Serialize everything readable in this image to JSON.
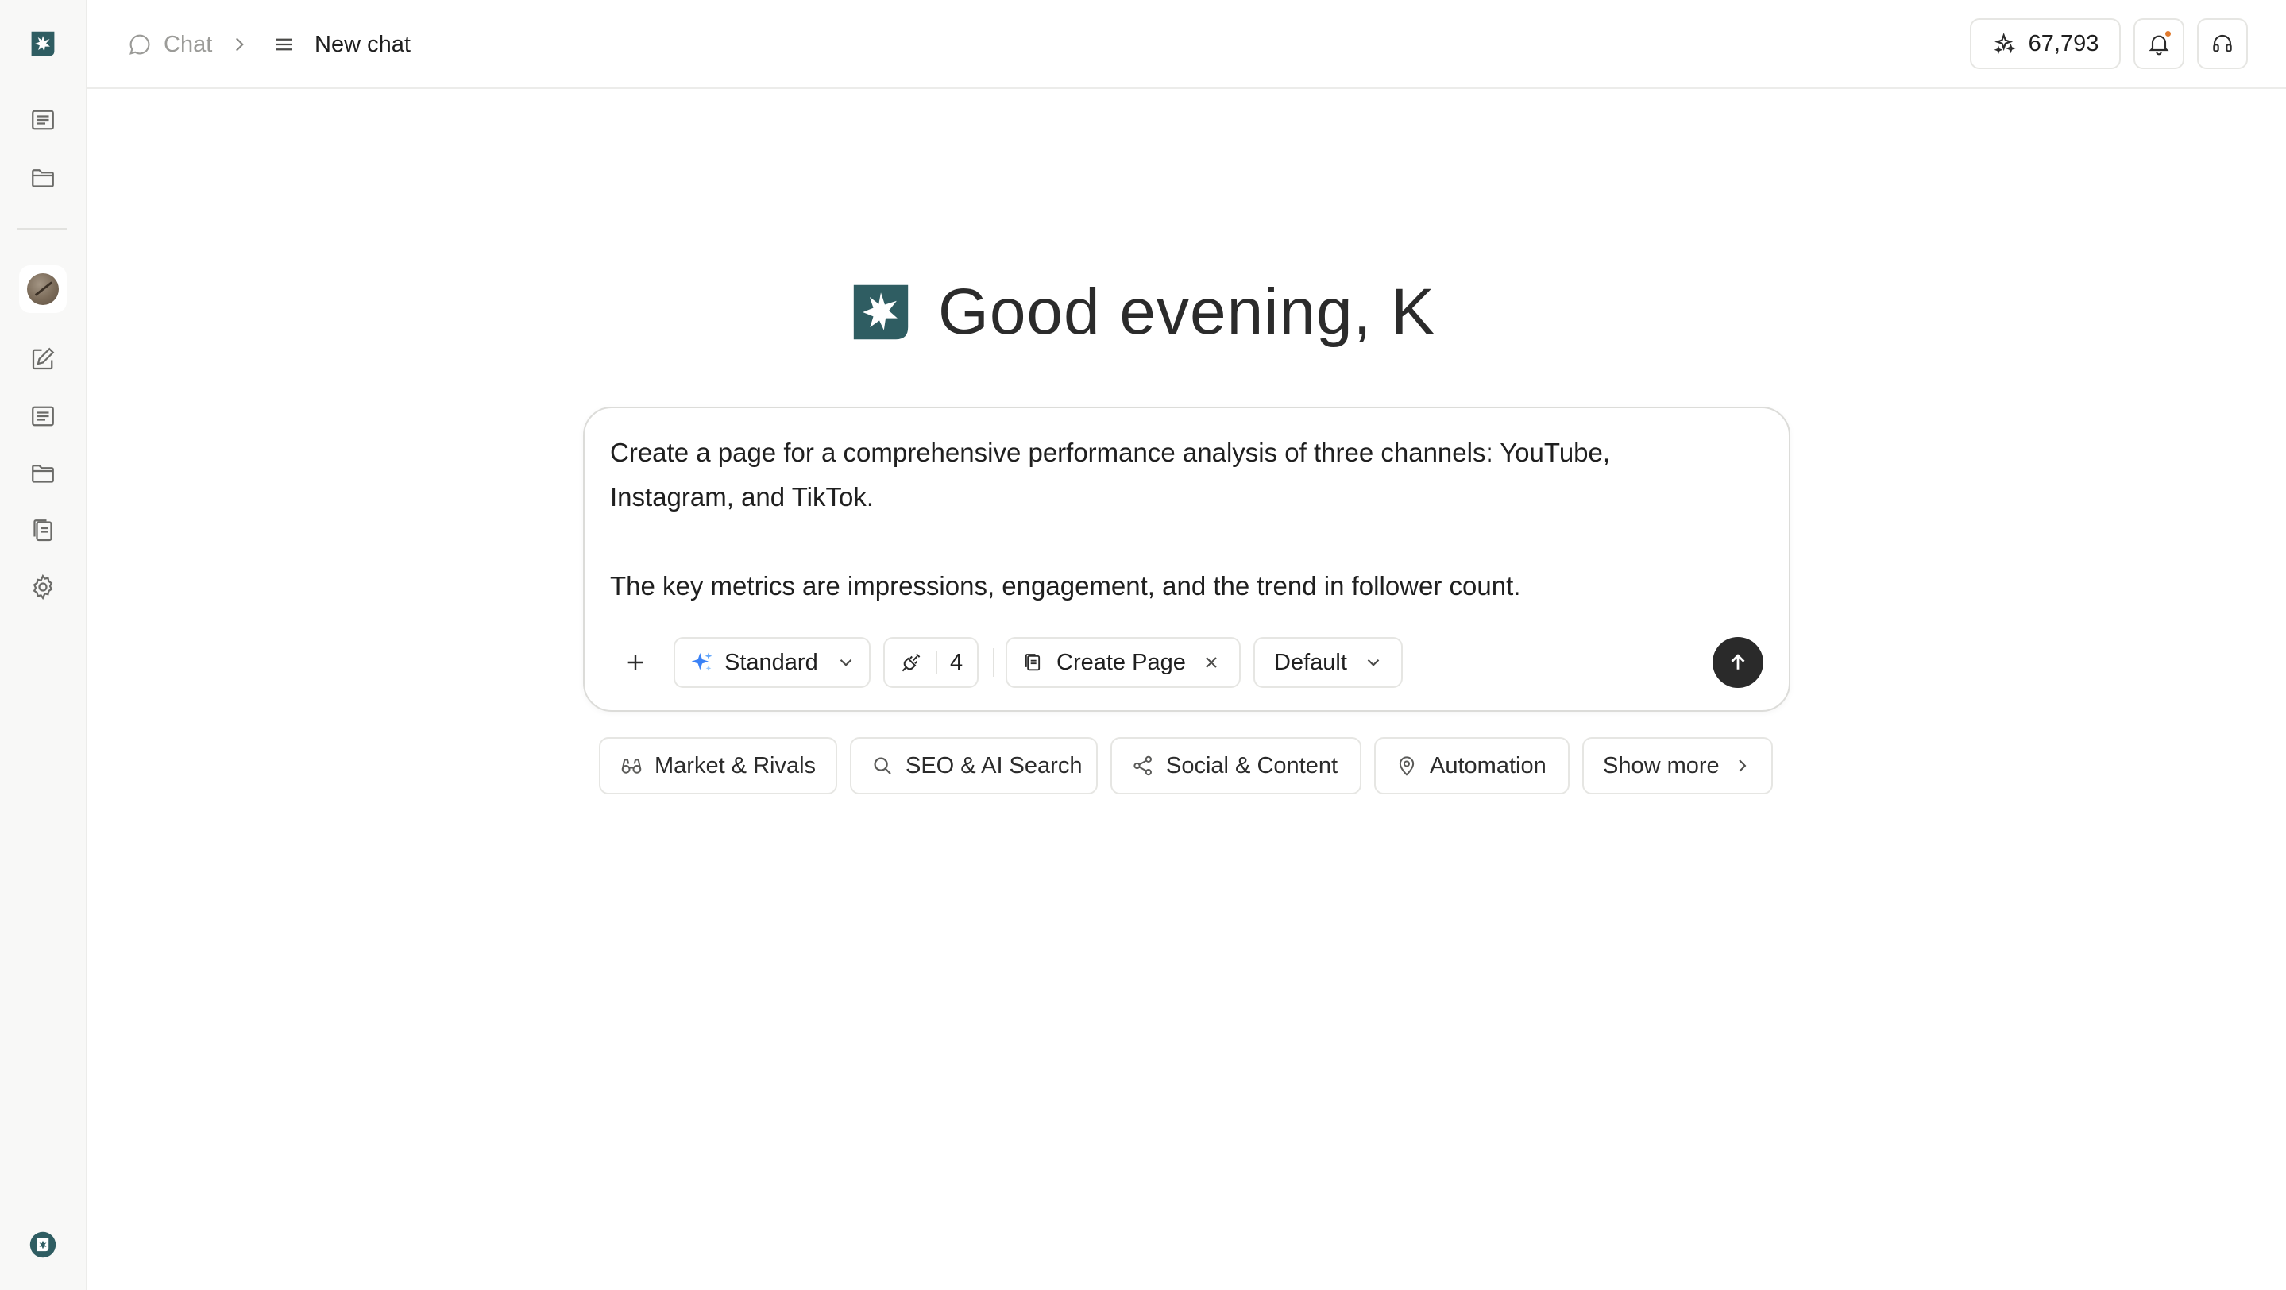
{
  "app": {
    "brand_color": "#2f5d62",
    "accent_color": "#e07a2e"
  },
  "breadcrumb": {
    "section": "Chat",
    "page": "New chat"
  },
  "topbar": {
    "credits": "67,793"
  },
  "greeting": "Good evening, K",
  "composer": {
    "lines": [
      "Create a page for a comprehensive performance analysis of three channels: YouTube,",
      "Instagram, and TikTok.",
      "",
      "The key metrics are impressions, engagement, and the trend in follower count."
    ],
    "mode": "Standard",
    "tools_count": "4",
    "attachment": "Create Page",
    "style": "Default"
  },
  "suggestions": [
    {
      "label": "Market & Rivals",
      "icon": "binoculars-icon"
    },
    {
      "label": "SEO & AI Search",
      "icon": "search-icon"
    },
    {
      "label": "Social & Content",
      "icon": "share-icon"
    },
    {
      "label": "Automation",
      "icon": "location-pin-icon"
    },
    {
      "label": "Show more",
      "icon": "chevron-right-icon"
    }
  ]
}
